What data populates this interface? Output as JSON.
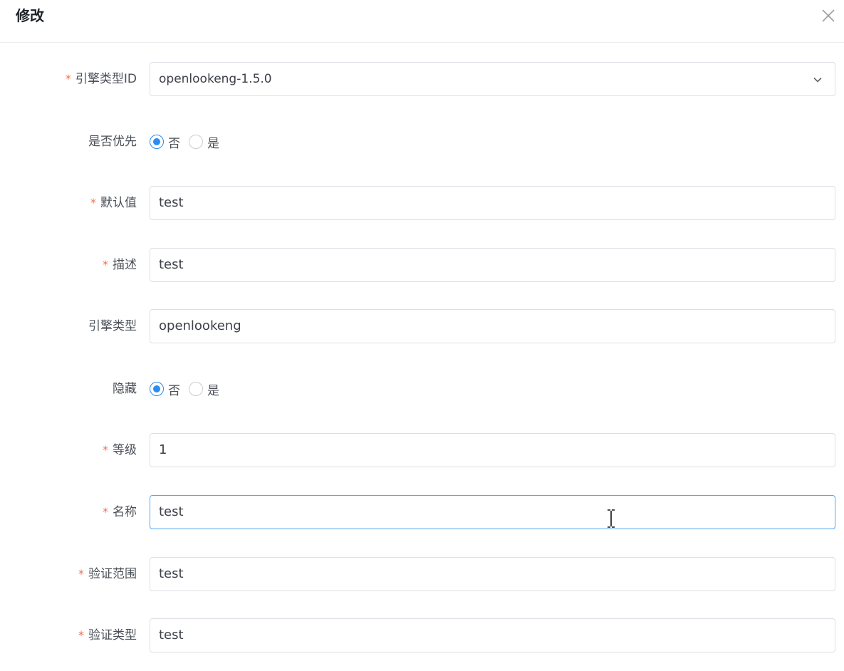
{
  "dialog": {
    "title": "修改"
  },
  "form": {
    "engine_type_id": {
      "label": "引擎类型ID",
      "value": "openlookeng-1.5.0",
      "required": true
    },
    "is_priority": {
      "label": "是否优先",
      "options": [
        "否",
        "是"
      ],
      "selected": "否"
    },
    "default_value": {
      "label": "默认值",
      "value": "test",
      "required": true
    },
    "description": {
      "label": "描述",
      "value": "test",
      "required": true
    },
    "engine_type": {
      "label": "引擎类型",
      "value": "openlookeng"
    },
    "hidden": {
      "label": "隐藏",
      "options": [
        "否",
        "是"
      ],
      "selected": "否"
    },
    "level": {
      "label": "等级",
      "value": "1",
      "required": true
    },
    "name": {
      "label": "名称",
      "value": "test",
      "required": true
    },
    "validation_range": {
      "label": "验证范围",
      "value": "test",
      "required": true
    },
    "validation_type": {
      "label": "验证类型",
      "value": "test",
      "required": true
    }
  },
  "required_mark": "*",
  "colors": {
    "accent": "#2d8cf0",
    "required": "#f56c49",
    "focus_border": "#4ea5f6"
  }
}
